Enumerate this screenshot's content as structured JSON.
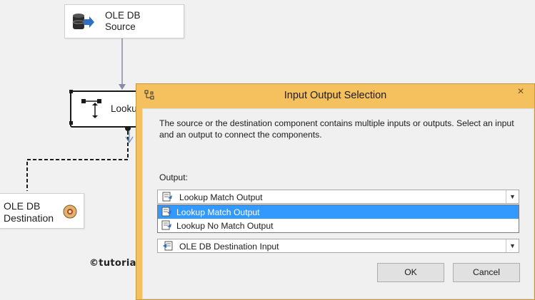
{
  "canvas": {
    "source": {
      "line1": "OLE DB",
      "line2": "Source",
      "icon": "database-source-icon"
    },
    "lookup": {
      "label": "Looku",
      "icon": "lookup-transform-icon"
    },
    "destination": {
      "line1": "OLE DB",
      "line2": "Destination",
      "icon": "destination-icon"
    },
    "watermark": "©tutorialgateway.org"
  },
  "dialog": {
    "title": "Input Output Selection",
    "description": "The source or the destination component contains multiple inputs or outputs. Select an input and an output to connect the components.",
    "output_label": "Output:",
    "output_value": "Lookup Match Output",
    "output_options": [
      "Lookup Match Output",
      "Lookup No Match Output"
    ],
    "selected_option": "Lookup Match Output",
    "input_value": "OLE DB Destination Input",
    "ok_label": "OK",
    "cancel_label": "Cancel",
    "close_glyph": "×"
  },
  "colors": {
    "titlebar": "#f5c15e",
    "selection": "#3399ff",
    "canvas": "#f1f1f1"
  }
}
